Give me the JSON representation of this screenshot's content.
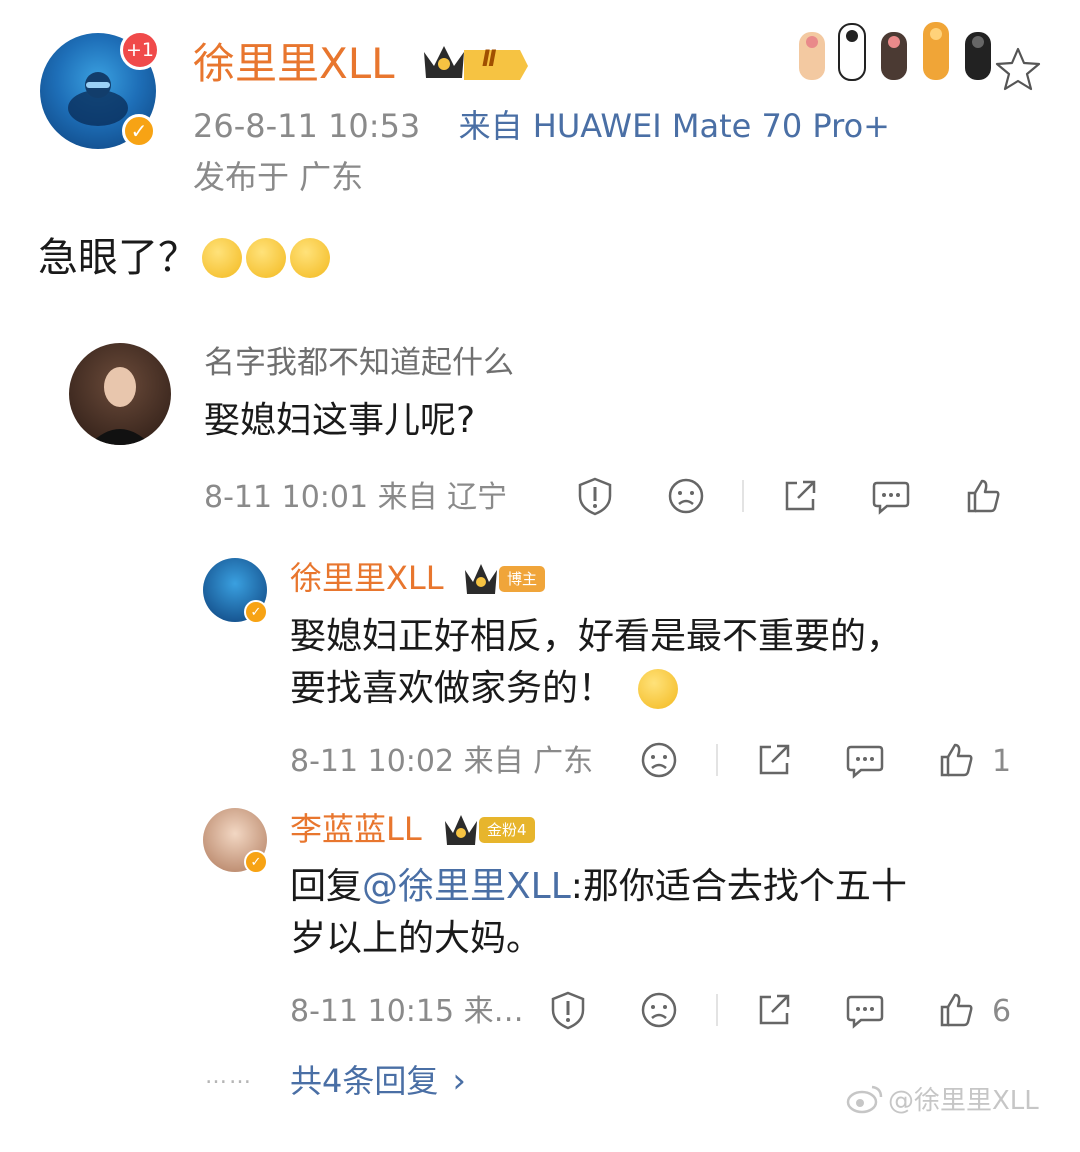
{
  "post": {
    "author": "徐里里XLL",
    "notification_count": "+1",
    "level_badge": "Ⅱ",
    "timestamp": "26-8-11 10:53",
    "source": "来自 HUAWEI Mate 70 Pro+",
    "location": "发布于 广东",
    "content": "急眼了？"
  },
  "comment": {
    "author": "名字我都不知道起什么",
    "content": "娶媳妇这事儿呢?",
    "meta": "8-11 10:01 来自 辽宁"
  },
  "replies": [
    {
      "author": "徐里里XLL",
      "tag": "博主",
      "content_line1": "娶媳妇正好相反，好看是最不重要的，",
      "content_line2": "要找喜欢做家务的！",
      "meta": "8-11 10:02 来自 广东",
      "like_count": "1"
    },
    {
      "author": "李蓝蓝LL",
      "tag": "金粉4",
      "reply_prefix": "回复",
      "mention": "@徐里里XLL",
      "content_line1_rest": ":那你适合去找个五十",
      "content_line2": "岁以上的大妈。",
      "meta": "8-11 10:15 来…",
      "like_count": "6"
    }
  ],
  "more_replies": {
    "dots": "……",
    "label": "共4条回复",
    "chevron": "›"
  },
  "watermark": "@徐里里XLL",
  "colors": {
    "username": "#e8762e",
    "meta": "#8a8a8a",
    "mention": "#4a6fa5",
    "blogger_tag": "#f0a53a",
    "fan_tag": "#e7b52c"
  }
}
